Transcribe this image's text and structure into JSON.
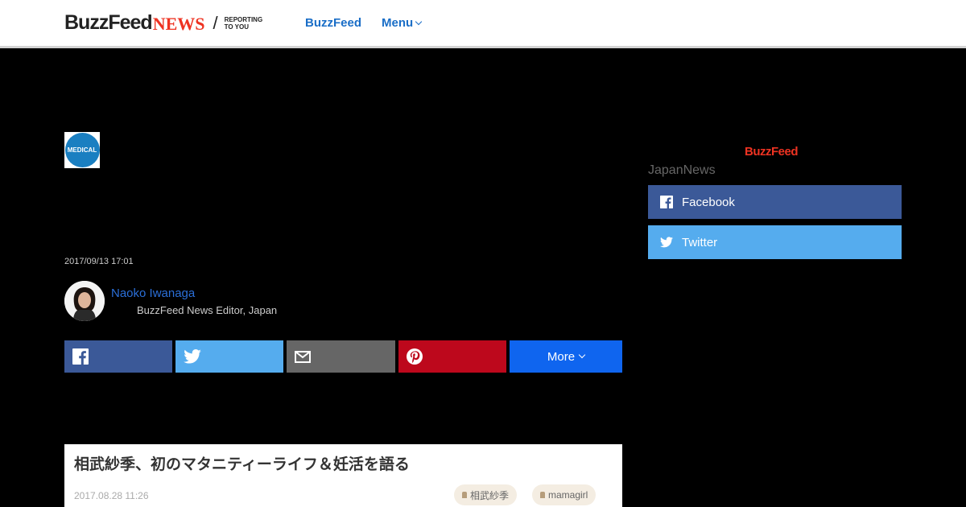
{
  "header": {
    "logo_buzz": "BuzzFeed",
    "logo_news": "NEWS",
    "logo_slash": "/",
    "logo_tagline": "REPORTING TO YOU",
    "nav_buzzfeed": "BuzzFeed",
    "nav_menu": "Menu"
  },
  "article": {
    "badge_label": "MEDICAL",
    "date": "2017/09/13 17:01",
    "author_name": "Naoko Iwanaga",
    "author_title": "BuzzFeed News Editor, Japan"
  },
  "share": {
    "more_label": "More",
    "icons": [
      "facebook-icon",
      "twitter-icon",
      "mail-icon",
      "pinterest-icon"
    ]
  },
  "embed": {
    "title": "相武紗季、初のマタニティーライフ＆妊活を語る",
    "date": "2017.08.28 11:26",
    "tags": [
      "相武紗季",
      "mamagirl"
    ]
  },
  "sidebar": {
    "logo": "BuzzFeed",
    "subtitle": "JapanNews",
    "facebook_label": "Facebook",
    "twitter_label": "Twitter"
  },
  "colors": {
    "facebook": "#3b5998",
    "twitter": "#55acee",
    "mail": "#666666",
    "pinterest": "#bd081c",
    "more": "#0f65ef",
    "news_red": "#ee3322",
    "link_blue": "#1a6ec7"
  }
}
